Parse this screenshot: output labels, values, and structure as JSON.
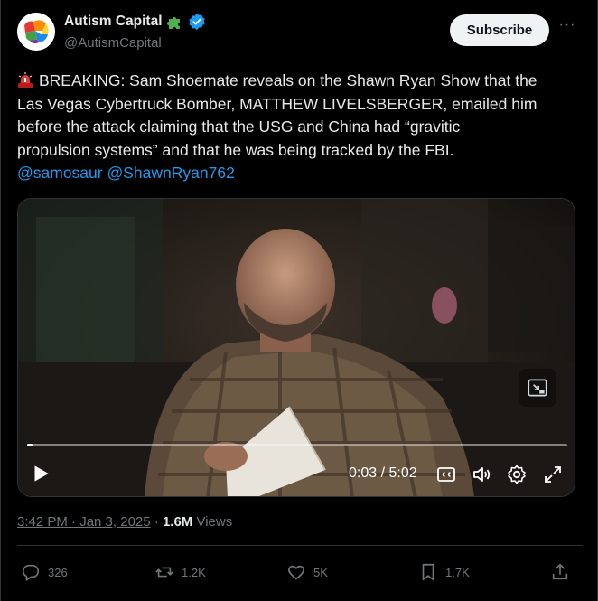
{
  "account": {
    "name": "Autism Capital",
    "handle": "@AutismCapital",
    "badge_icons": [
      "puzzle-piece-icon",
      "verified-badge-icon"
    ]
  },
  "subscribe_label": "Subscribe",
  "more_icon": "more-options-icon",
  "tweet": {
    "line1": "BREAKING: Sam Shoemate reveals on the Shawn Ryan Show that the",
    "line2": "Las Vegas Cybertruck Bomber, MATTHEW LIVELSBERGER, emailed him",
    "line3": "before the attack claiming that the USG and China had “gravitic",
    "line4": "propulsion systems” and that he was being tracked by the FBI.",
    "mention1": "@samosaur",
    "mention2": "@ShawnRyan762"
  },
  "video": {
    "current_time": "0:03",
    "duration": "5:02",
    "time_display": "0:03 / 5:02",
    "progress_fraction": 0.01,
    "controls": [
      "play-icon",
      "captions-icon",
      "volume-icon",
      "settings-icon",
      "fullscreen-icon"
    ]
  },
  "meta": {
    "time": "3:42 PM · Jan 3, 2025",
    "separator": "·",
    "views_count": "1.6M",
    "views_label": "Views"
  },
  "actions": {
    "replies": "326",
    "reposts": "1.2K",
    "likes": "5K",
    "bookmarks": "1.7K"
  },
  "colors": {
    "background": "#000000",
    "text": "#e7e9ea",
    "muted": "#71767b",
    "link": "#1d9bf0",
    "verified": "#1d9bf0",
    "subscribe_bg": "#eff3f4"
  }
}
